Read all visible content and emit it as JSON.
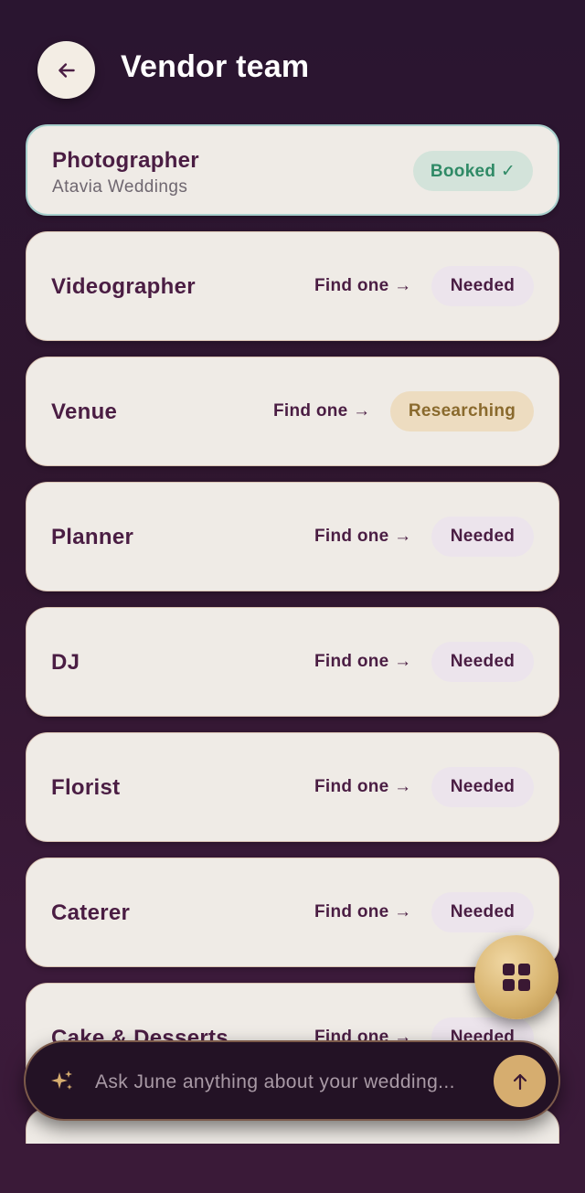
{
  "header": {
    "title": "Vendor team",
    "back_icon": "arrow-left-icon"
  },
  "colors": {
    "background": "#2a1530",
    "card": "#efebe6",
    "plum": "#4a1d43",
    "booked_green": "#2f8a66",
    "research_gold": "#8a6a2d",
    "gold_accent": "#d6ad6f"
  },
  "vendors": [
    {
      "name": "Photographer",
      "sub": "Atavia Weddings",
      "status": "Booked ✓",
      "status_type": "booked",
      "action": ""
    },
    {
      "name": "Videographer",
      "sub": "",
      "status": "Needed",
      "status_type": "needed",
      "action": "Find one →"
    },
    {
      "name": "Venue",
      "sub": "",
      "status": "Researching",
      "status_type": "research",
      "action": "Find one →"
    },
    {
      "name": "Planner",
      "sub": "",
      "status": "Needed",
      "status_type": "needed",
      "action": "Find one →"
    },
    {
      "name": "DJ",
      "sub": "",
      "status": "Needed",
      "status_type": "needed",
      "action": "Find one →"
    },
    {
      "name": "Florist",
      "sub": "",
      "status": "Needed",
      "status_type": "needed",
      "action": "Find one →"
    },
    {
      "name": "Caterer",
      "sub": "",
      "status": "Needed",
      "status_type": "needed",
      "action": "Find one →"
    },
    {
      "name": "Cake & Desserts",
      "sub": "",
      "status": "Needed",
      "status_type": "needed",
      "action": "Find one →"
    }
  ],
  "fab": {
    "icon": "grid-icon"
  },
  "ask_bar": {
    "placeholder": "Ask June anything about your wedding...",
    "sparkle_icon": "sparkle-icon",
    "send_icon": "arrow-up-icon"
  }
}
